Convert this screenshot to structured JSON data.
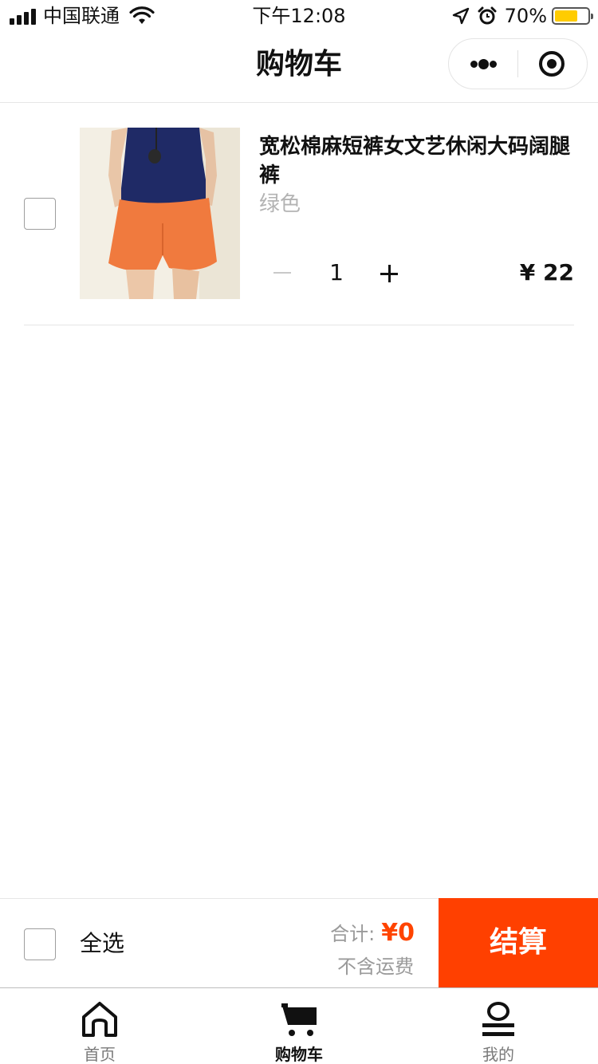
{
  "status_bar": {
    "carrier": "中国联通",
    "time": "下午12:08",
    "battery_percent": "70%",
    "battery_level": 0.7,
    "battery_color": "#ffcc00"
  },
  "nav": {
    "title": "购物车",
    "more_icon": "more-dots-icon",
    "close_icon": "target-circle-icon"
  },
  "cart": {
    "items": [
      {
        "title": "宽松棉麻短裤女文艺休闲大码阔腿裤",
        "spec": "绿色",
        "quantity": "1",
        "price": "¥ 22",
        "checked": false
      }
    ]
  },
  "footer": {
    "select_all_label": "全选",
    "total_label": "合计:",
    "total_value": "¥0",
    "shipping_note": "不含运费",
    "checkout_label": "结算",
    "accent_color": "#ff4000"
  },
  "tabs": [
    {
      "label": "首页",
      "icon": "home-icon",
      "active": false
    },
    {
      "label": "购物车",
      "icon": "cart-icon",
      "active": true
    },
    {
      "label": "我的",
      "icon": "profile-icon",
      "active": false
    }
  ]
}
